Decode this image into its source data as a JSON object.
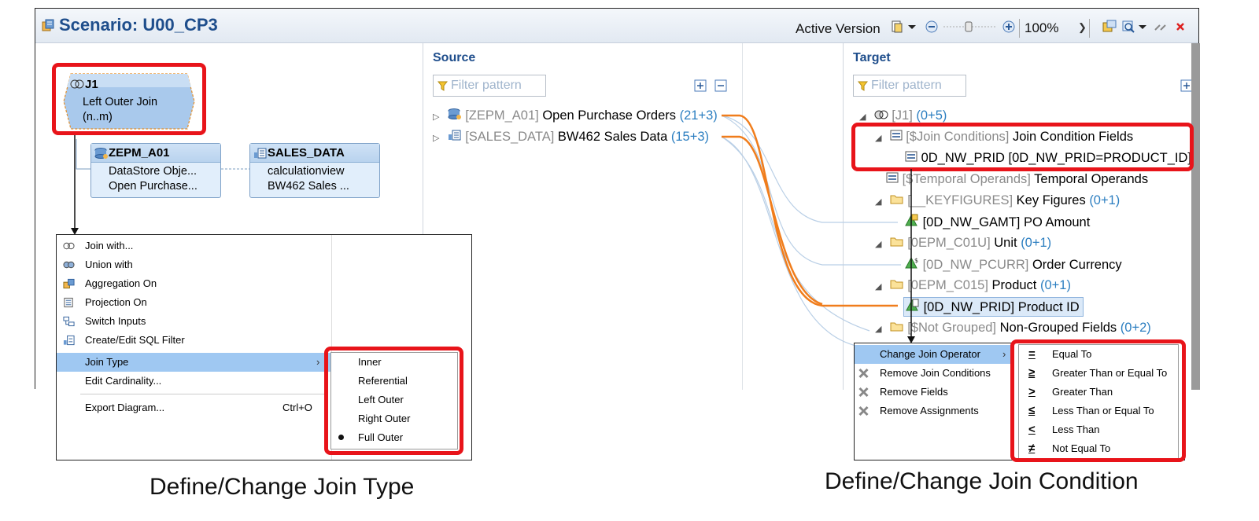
{
  "window": {
    "title": "Scenario: U00_CP3",
    "toolbar": {
      "active_version": "Active Version",
      "zoom": "100%"
    }
  },
  "diagram": {
    "join_node": {
      "title": "J1",
      "line1": "Left Outer Join",
      "line2": "(n..m)"
    },
    "nodes": [
      {
        "title": "ZEPM_A01",
        "line1": "DataStore Obje...",
        "line2": "Open Purchase..."
      },
      {
        "title": "SALES_DATA",
        "line1": "calculationview",
        "line2": "BW462 Sales ..."
      }
    ]
  },
  "source": {
    "title": "Source",
    "filter_placeholder": "Filter pattern",
    "rows": [
      {
        "key": "[ZEPM_A01]",
        "label": "Open Purchase Orders",
        "count": "(21+3)"
      },
      {
        "key": "[SALES_DATA]",
        "label": "BW462 Sales Data",
        "count": "(15+3)"
      }
    ]
  },
  "target": {
    "title": "Target",
    "filter_placeholder": "Filter pattern",
    "rows": [
      {
        "key": "[J1]",
        "label": "",
        "count": "(0+5)"
      },
      {
        "key": "[$Join Conditions]",
        "label": "Join Condition Fields",
        "count": ""
      },
      {
        "key": "",
        "label": "0D_NW_PRID [0D_NW_PRID=PRODUCT_ID]",
        "count": ""
      },
      {
        "key": "[$Temporal Operands]",
        "label": "Temporal Operands",
        "count": ""
      },
      {
        "key": "[__KEYFIGURES]",
        "label": "Key Figures",
        "count": "(0+1)"
      },
      {
        "key": "",
        "label": "[0D_NW_GAMT] PO Amount",
        "count": ""
      },
      {
        "key": "[0EPM_C01U]",
        "label": "Unit",
        "count": "(0+1)"
      },
      {
        "key": "[0D_NW_PCURR]",
        "label": "Order Currency",
        "count": ""
      },
      {
        "key": "[0EPM_C015]",
        "label": "Product",
        "count": "(0+1)"
      },
      {
        "key": "",
        "label": "[0D_NW_PRID] Product ID",
        "count": ""
      },
      {
        "key": "[$Not Grouped]",
        "label": "Non-Grouped Fields",
        "count": "(0+2)"
      }
    ]
  },
  "left_menu": {
    "items": [
      {
        "label": "Join with...",
        "icon": "join-icon"
      },
      {
        "label": "Union with",
        "icon": "union-icon"
      },
      {
        "label": "Aggregation On",
        "icon": "aggregation-icon"
      },
      {
        "label": "Projection On",
        "icon": "projection-icon"
      },
      {
        "label": "Switch Inputs",
        "icon": "switch-icon"
      },
      {
        "label": "Create/Edit SQL Filter",
        "icon": "filter-icon"
      },
      {
        "label": "Join Type",
        "icon": ""
      },
      {
        "label": "Edit Cardinality...",
        "icon": ""
      },
      {
        "label": "Export Diagram...",
        "icon": "",
        "shortcut": "Ctrl+O"
      }
    ],
    "submenu": [
      "Inner",
      "Referential",
      "Left Outer",
      "Right Outer",
      "Full Outer"
    ],
    "checked": "Full Outer"
  },
  "right_menu": {
    "items": [
      {
        "label": "Change Join Operator",
        "icon": ""
      },
      {
        "label": "Remove Join Conditions",
        "icon": "remove-icon"
      },
      {
        "label": "Remove Fields",
        "icon": "remove-icon"
      },
      {
        "label": "Remove Assignments",
        "icon": "remove-icon"
      }
    ],
    "submenu": [
      {
        "symbol": "=",
        "label": "Equal To"
      },
      {
        "symbol": "≥",
        "label": "Greater Than or Equal To"
      },
      {
        "symbol": ">",
        "label": "Greater Than"
      },
      {
        "symbol": "≤",
        "label": "Less Than or Equal To"
      },
      {
        "symbol": "<",
        "label": "Less Than"
      },
      {
        "symbol": "≠",
        "label": "Not Equal To"
      }
    ]
  },
  "captions": {
    "left": "Define/Change Join Type",
    "right": "Define/Change Join Condition"
  },
  "colors": {
    "highlight": "#e8141a",
    "mapping_line": "#f07d1c",
    "title_blue": "#1f4e8c"
  }
}
